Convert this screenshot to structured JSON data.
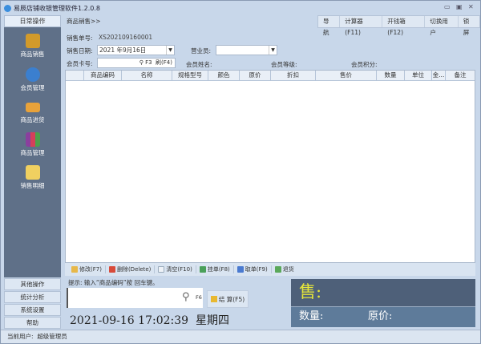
{
  "window": {
    "title": "易辰店铺收银管理软件1.2.0.8"
  },
  "sidebar": {
    "tab": "日常操作",
    "items": [
      {
        "label": "商品销售",
        "icon": "cart-icon",
        "color": "#d29a2a"
      },
      {
        "label": "会员管理",
        "icon": "users-icon",
        "color": "#3b7fcf"
      },
      {
        "label": "商品进货",
        "icon": "truck-icon",
        "color": "#e8a23a"
      },
      {
        "label": "商品管理",
        "icon": "books-icon",
        "color": "#8a3f9e"
      },
      {
        "label": "销售明细",
        "icon": "magnifier-doc-icon",
        "color": "#f0d060"
      }
    ],
    "bottom": [
      "其他操作",
      "统计分析",
      "系统设置",
      "帮助"
    ]
  },
  "breadcrumb": "商品销售>>",
  "toolbar": [
    "导航",
    "计算器(F11)",
    "开钱箱(F12)",
    "切换用户",
    "锁屏"
  ],
  "form": {
    "order_label": "销售单号:",
    "order_no": "XS202109160001",
    "date_label": "销售日期:",
    "date": "2021 年9月16日",
    "clerk_label": "营业员:",
    "clerk": "",
    "card_label": "会员卡号:",
    "card_hint": "F3",
    "swipe": "刷(F4)",
    "name_label": "会员姓名:",
    "level_label": "会员等级:",
    "points_label": "会员积分:"
  },
  "table": {
    "columns": [
      "",
      "商品编码",
      "名称",
      "规格型号",
      "颜色",
      "原价",
      "折扣",
      "售价",
      "数量",
      "单位",
      "金...",
      "备注"
    ]
  },
  "actions": [
    "修改(F7)",
    "删除(Delete)",
    "清空(F10)",
    "挂单(F8)",
    "取单(F9)",
    "退货"
  ],
  "hint": "提示: 输入“商品编码”按 回车键。",
  "input": {
    "value": "",
    "shortcut": "F6"
  },
  "checkout": "结 算(F5)",
  "datetime": "2021-09-16 17:02:39  星期四",
  "display": {
    "sale": "售:",
    "qty": "数量:",
    "price": "原价:"
  },
  "status": {
    "label": "当前用户:",
    "user": "超级管理员"
  }
}
